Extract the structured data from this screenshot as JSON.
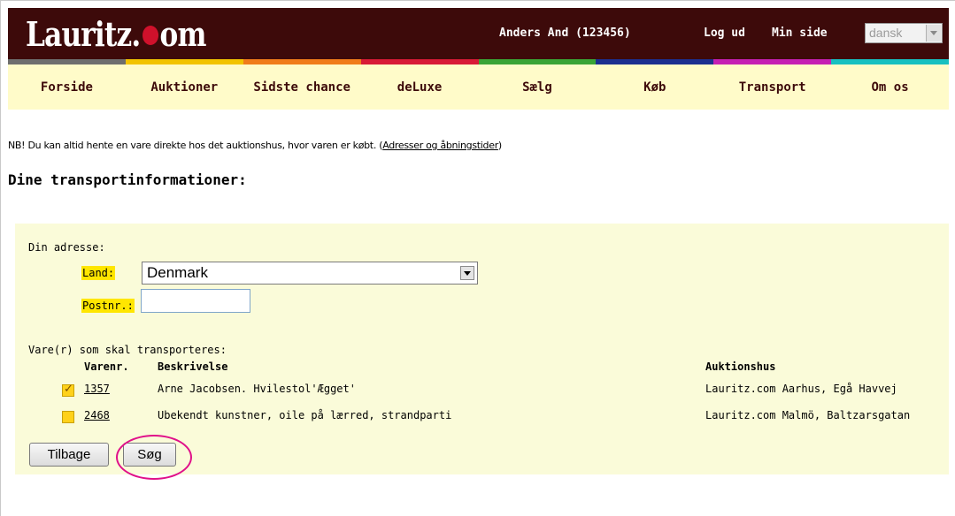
{
  "header": {
    "logo_text_left": "Lauritz.",
    "logo_text_right": "om",
    "user": "Anders And (123456)",
    "logout_label": "Log ud",
    "my_page_label": "Min side",
    "language_value": "dansk",
    "color_strip": [
      "#6e6e6e",
      "#f2c300",
      "#f07c1a",
      "#d81a36",
      "#3aa435",
      "#1c2f8f",
      "#c51fb3",
      "#17c0c0"
    ]
  },
  "nav": {
    "items": [
      "Forside",
      "Auktioner",
      "Sidste chance",
      "deLuxe",
      "Sælg",
      "Køb",
      "Transport",
      "Om os"
    ]
  },
  "main": {
    "notice_text": "NB! Du kan altid hente en vare direkte hos det auktionshus, hvor varen er købt. (",
    "notice_link": "Adresser og åbningstider",
    "notice_end": ")",
    "title": "Dine transportinformationer:"
  },
  "form": {
    "address_label": "Din adresse:",
    "country_label": "Land:",
    "country_value": "Denmark",
    "postcode_label": "Postnr.:",
    "postcode_value": "",
    "items_label": "Vare(r) som skal transporteres:",
    "columns": {
      "lot": "Varenr.",
      "description": "Beskrivelse",
      "house": "Auktionshus"
    },
    "rows": [
      {
        "checked": true,
        "lot": "1357",
        "description": "Arne Jacobsen. Hvilestol'Ægget'",
        "house": "Lauritz.com Aarhus, Egå Havvej"
      },
      {
        "checked": false,
        "lot": "2468",
        "description": "Ubekendt kunstner, oile på lærred, strandparti",
        "house": "Lauritz.com Malmö, Baltzarsgatan"
      }
    ],
    "back_label": "Tilbage",
    "search_label": "Søg"
  }
}
